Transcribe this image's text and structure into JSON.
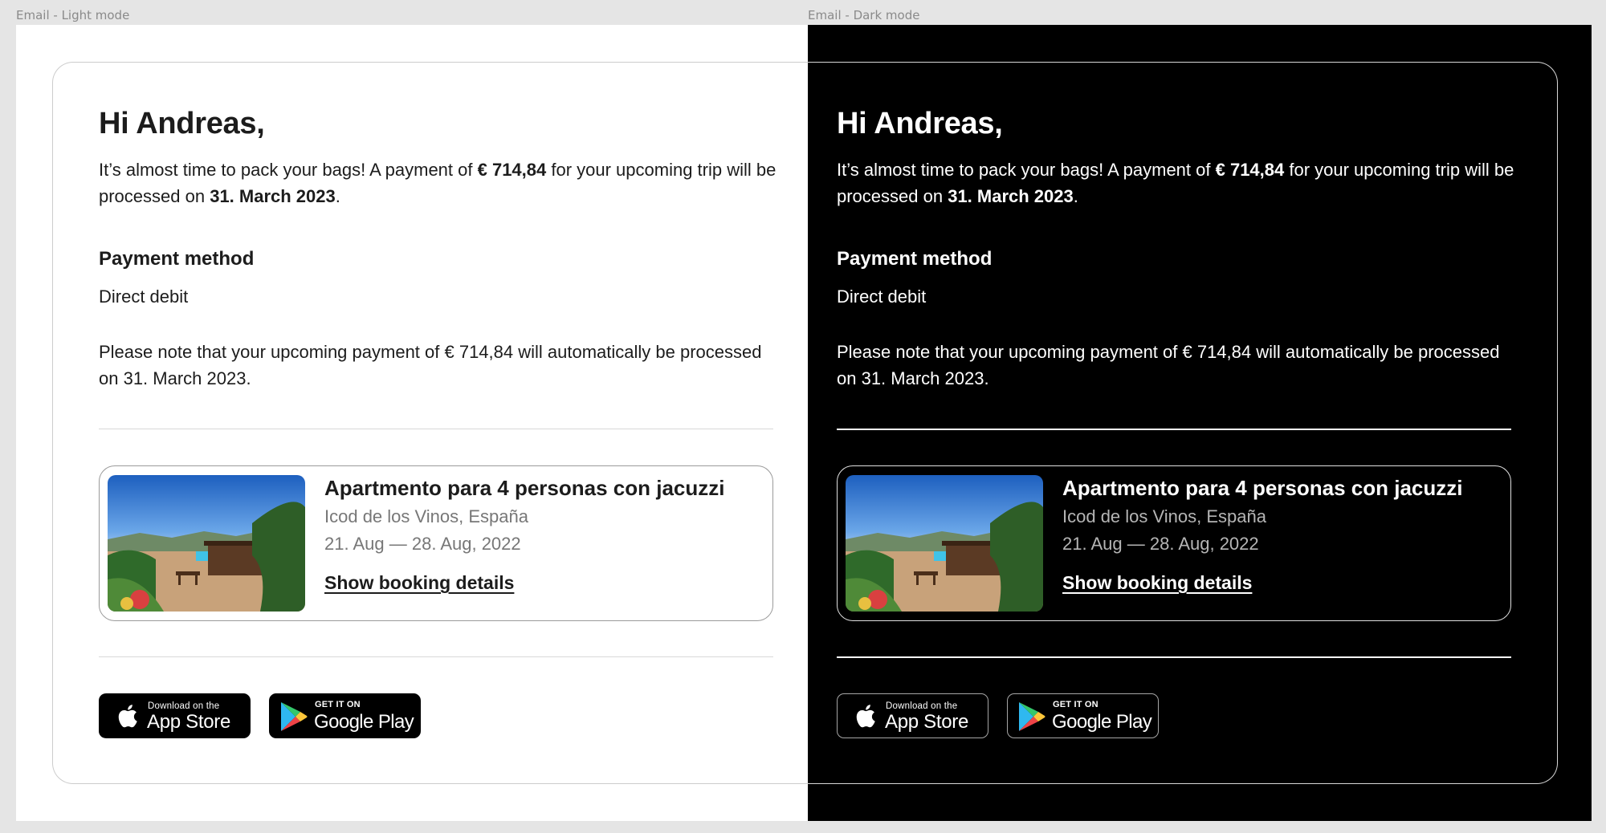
{
  "frames": {
    "light": {
      "label": "Email - Light mode"
    },
    "dark": {
      "label": "Email - Dark mode"
    }
  },
  "email": {
    "greeting": "Hi Andreas,",
    "intro": {
      "part1": "It’s almost time to pack your bags! A payment of ",
      "amount": "€ 714,84",
      "part2": " for your upcoming trip will be processed on ",
      "date": "31. March 2023",
      "part3": "."
    },
    "payment_method": {
      "heading": "Payment method",
      "value": "Direct debit"
    },
    "note": "Please note that your upcoming payment of € 714,84 will automatically be processed on 31. March 2023.",
    "booking": {
      "title": "Apartmento para 4 personas con jacuzzi",
      "location": "Icod de los Vinos, España",
      "dates": "21. Aug — 28. Aug, 2022",
      "link_label": "Show booking details"
    },
    "badges": {
      "app_store": {
        "small": "Download on the",
        "big": "App Store",
        "icon": "apple-icon"
      },
      "google_play": {
        "small": "GET IT ON",
        "big": "Google Play",
        "icon": "google-play-icon"
      }
    }
  },
  "colors": {
    "light_background": "#ffffff",
    "dark_background": "#000000",
    "canvas": "#e5e5e5",
    "secondary_text": "#777777"
  }
}
